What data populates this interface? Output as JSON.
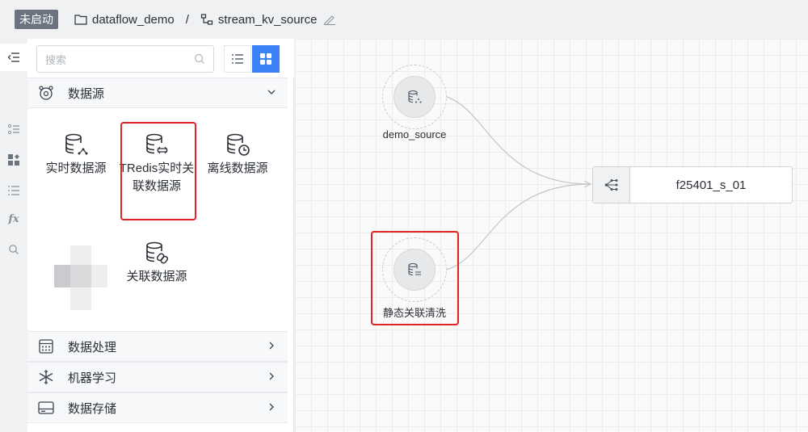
{
  "header": {
    "status": "未启动",
    "project": "dataflow_demo",
    "separator": "/",
    "flow_name": "stream_kv_source"
  },
  "panel": {
    "search_placeholder": "搜索",
    "categories": {
      "data_source": "数据源",
      "data_processing": "数据处理",
      "machine_learning": "机器学习",
      "data_storage": "数据存储"
    },
    "nodes": [
      {
        "label": "实时数据源",
        "icon": "realtime-db-icon"
      },
      {
        "label": "TRedis实时关联数据源",
        "icon": "tredis-db-icon"
      },
      {
        "label": "离线数据源",
        "icon": "offline-db-icon"
      },
      {
        "label": "关联数据源",
        "icon": "join-db-icon"
      }
    ]
  },
  "canvas": {
    "nodes": [
      {
        "label": "demo_source",
        "icon": "stream-db-icon"
      },
      {
        "label": "静态关联清洗",
        "icon": "static-db-icon"
      },
      {
        "label": "f25401_s_01",
        "icon": "process-icon"
      }
    ]
  },
  "colors": {
    "accent": "#3b82f6",
    "highlight": "#e02424",
    "status_badge": "#6b7280"
  }
}
